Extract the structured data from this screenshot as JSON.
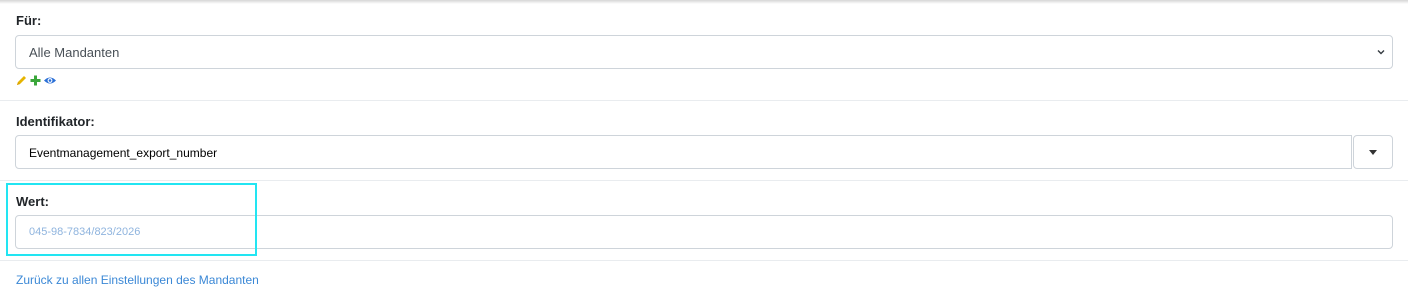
{
  "fuer": {
    "label": "Für:",
    "selected": "Alle Mandanten",
    "icons": [
      "pencil-icon",
      "plus-icon",
      "eye-icon"
    ]
  },
  "identifikator": {
    "label": "Identifikator:",
    "value": "Eventmanagement_export_number"
  },
  "wert": {
    "label": "Wert:",
    "placeholder": "045-98-7834/823/2026"
  },
  "back_link": "Zurück zu allen Einstellungen des Mandanten",
  "colors": {
    "highlight": "#22e5f2",
    "link": "#3b88d6",
    "pencil": "#e6b400",
    "plus": "#3aa63a",
    "eye": "#2a6fd6"
  }
}
